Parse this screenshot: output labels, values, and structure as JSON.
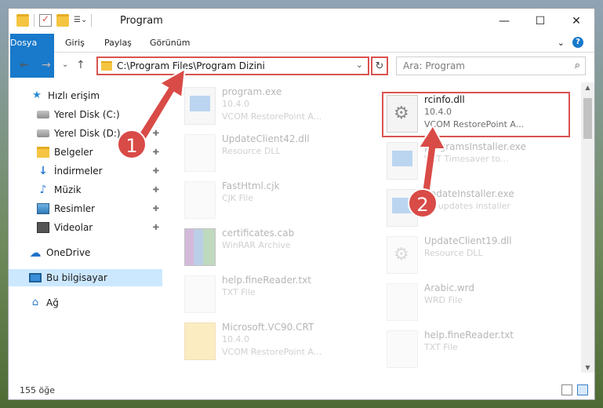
{
  "window": {
    "title": "Program"
  },
  "window_controls": {
    "minimize": "—",
    "maximize": "☐",
    "close": "✕"
  },
  "ribbon": {
    "tabs": [
      {
        "label": "Dosya"
      },
      {
        "label": "Giriş"
      },
      {
        "label": "Paylaş"
      },
      {
        "label": "Görünüm"
      }
    ],
    "expand": "⌄",
    "help": "?"
  },
  "nav": {
    "back": "←",
    "forward": "→",
    "recent": "⌄",
    "up": "↑"
  },
  "address": {
    "path": "C:\\Program Files\\Program Dizini",
    "dropdown": "⌄",
    "refresh": "↻"
  },
  "search": {
    "placeholder": "Ara: Program",
    "icon": "⌕"
  },
  "sidebar": {
    "items": [
      {
        "label": "Hızlı erişim",
        "icon": "star-icon"
      },
      {
        "label": "Yerel Disk (C:)",
        "icon": "drive-icon",
        "pin": "✚"
      },
      {
        "label": "Yerel Disk (D:)",
        "icon": "drive-icon",
        "pin": "✚"
      },
      {
        "label": "Belgeler",
        "icon": "documents-icon",
        "pin": "✚"
      },
      {
        "label": "İndirmeler",
        "icon": "download-icon",
        "pin": "✚"
      },
      {
        "label": "Müzik",
        "icon": "music-icon",
        "pin": "✚"
      },
      {
        "label": "Resimler",
        "icon": "pictures-icon",
        "pin": "✚"
      },
      {
        "label": "Videolar",
        "icon": "videos-icon",
        "pin": "✚"
      },
      {
        "label": "OneDrive",
        "icon": "cloud-icon"
      },
      {
        "label": "Bu bilgisayar",
        "icon": "computer-icon"
      },
      {
        "label": "Ağ",
        "icon": "network-icon"
      }
    ]
  },
  "files": [
    {
      "name": "program.exe",
      "line1": "10.4.0",
      "line2": "VCOM RestorePoint A...",
      "icon": "exe-icon"
    },
    {
      "name": "rcinfo.dll",
      "line1": "10.4.0",
      "line2": "VCOM RestorePoint A...",
      "icon": "dll-gear-icon"
    },
    {
      "name": "UpdateClient42.dll",
      "line1": "Resource DLL",
      "line2": "",
      "icon": "blank-file-icon"
    },
    {
      "name": "programsInstaller.exe",
      "line1": "VCT Timesaver to...",
      "line2": "",
      "icon": "exe-icon"
    },
    {
      "name": "FastHtml.cjk",
      "line1": "CJK File",
      "line2": "",
      "icon": "blank-file-icon"
    },
    {
      "name": "updateInstaller.exe",
      "line1": "VY updates installer",
      "line2": "",
      "icon": "exe-icon"
    },
    {
      "name": "certificates.cab",
      "line1": "WinRAR Archive",
      "line2": "",
      "icon": "archive-icon"
    },
    {
      "name": "UpdateClient19.dll",
      "line1": "Resource DLL",
      "line2": "",
      "icon": "dll-gear-icon"
    },
    {
      "name": "help.fineReader.txt",
      "line1": "TXT File",
      "line2": "",
      "icon": "blank-file-icon"
    },
    {
      "name": "Arabic.wrd",
      "line1": "WRD File",
      "line2": "",
      "icon": "blank-file-icon"
    },
    {
      "name": "Microsoft.VC90.CRT",
      "line1": "10.4.0",
      "line2": "VCOM RestorePoint A...",
      "icon": "document-icon"
    },
    {
      "name": "help.fineReader.txt",
      "line1": "TXT File",
      "line2": "",
      "icon": "blank-file-icon"
    }
  ],
  "status": {
    "count": "155 öğe"
  },
  "annotations": {
    "step1": "1",
    "step2": "2"
  },
  "colors": {
    "accent": "#1979ca",
    "highlight": "#d9534f",
    "selected": "#cce8ff"
  }
}
